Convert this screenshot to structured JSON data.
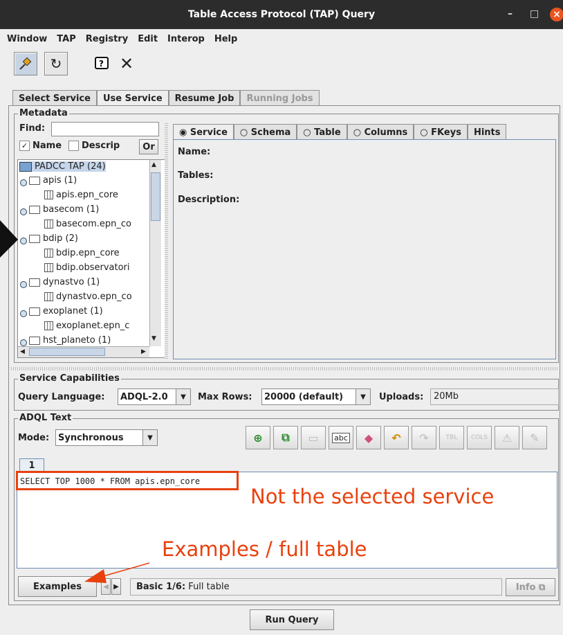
{
  "window": {
    "title": "Table Access Protocol (TAP) Query",
    "minimize": "–",
    "maximize": "□",
    "close": "×"
  },
  "menu": [
    "Window",
    "TAP",
    "Registry",
    "Edit",
    "Interop",
    "Help"
  ],
  "main_tabs": [
    "Select Service",
    "Use Service",
    "Resume Job",
    "Running Jobs"
  ],
  "metadata": {
    "label": "Metadata",
    "find_label": "Find:",
    "find_value": "",
    "name_check": "Name",
    "descrip_check": "Descrip",
    "or_button": "Or",
    "tree": [
      {
        "text": "PADCC TAP (24)",
        "kind": "root"
      },
      {
        "text": "apis (1)",
        "kind": "schema"
      },
      {
        "text": "apis.epn_core",
        "kind": "table"
      },
      {
        "text": "basecom (1)",
        "kind": "schema"
      },
      {
        "text": "basecom.epn_co",
        "kind": "table"
      },
      {
        "text": "bdip (2)",
        "kind": "schema"
      },
      {
        "text": "bdip.epn_core",
        "kind": "table"
      },
      {
        "text": "bdip.observatori",
        "kind": "table"
      },
      {
        "text": "dynastvo (1)",
        "kind": "schema"
      },
      {
        "text": "dynastvo.epn_co",
        "kind": "table"
      },
      {
        "text": "exoplanet (1)",
        "kind": "schema"
      },
      {
        "text": "exoplanet.epn_c",
        "kind": "table"
      },
      {
        "text": "hst_planeto (1)",
        "kind": "schema"
      }
    ],
    "detail_tabs": [
      "Service",
      "Schema",
      "Table",
      "Columns",
      "FKeys",
      "Hints"
    ],
    "detail_selected": "Service",
    "detail_fields": [
      "Name:",
      "Tables:",
      "Description:"
    ]
  },
  "capabilities": {
    "label": "Service Capabilities",
    "query_language_label": "Query Language:",
    "query_language_value": "ADQL-2.0",
    "max_rows_label": "Max Rows:",
    "max_rows_value": "20000 (default)",
    "uploads_label": "Uploads:",
    "uploads_value": "20Mb"
  },
  "adql": {
    "label": "ADQL Text",
    "mode_label": "Mode:",
    "mode_value": "Synchronous",
    "text_tab": "1",
    "query_text": "SELECT TOP 1000 * FROM apis.epn_core",
    "examples_button": "Examples",
    "example_name": "Basic 1/6:",
    "example_desc": "Full table",
    "info_button": "Info ⧉"
  },
  "run_button": "Run Query",
  "annotations": {
    "not_selected": "Not the selected service",
    "examples": "Examples / full table"
  },
  "colors": {
    "accent_annotation": "#e8410e",
    "titlebar": "#2c2c2c",
    "close_button": "#e95420"
  }
}
